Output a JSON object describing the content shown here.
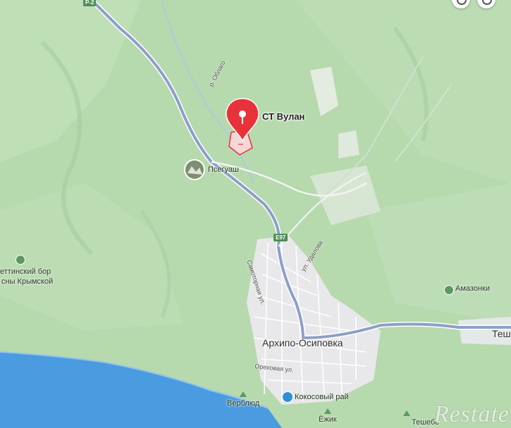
{
  "map": {
    "colors": {
      "forest": "#b9dbb2",
      "sea": "#4a9be0",
      "road": "#8c9fc7",
      "marker": "#e8323a"
    },
    "pin": {
      "title": "СТ Вулан"
    },
    "settlements": {
      "psegush": "Псегуаш",
      "arkhipo": "Архипо-Осиповка",
      "amazonki": "Амазонки",
      "teshe": "Теше",
      "verblyud": "Верблюд",
      "kokosovy": "Кокосовый рай",
      "ezhik": "Ёжик",
      "teshebs": "Тешебс",
      "bor_line1": "еттинский бор",
      "bor_line2": "сны Крымской"
    },
    "streets": {
      "oblago": "р. Облаго",
      "samotornaya": "Самоторная ул.",
      "udalova": "ул. Удалова",
      "orekhovaya": "Ореховая ул."
    },
    "roads": {
      "e97": "E97",
      "r": "Р-2"
    },
    "watermark": "Restate"
  }
}
